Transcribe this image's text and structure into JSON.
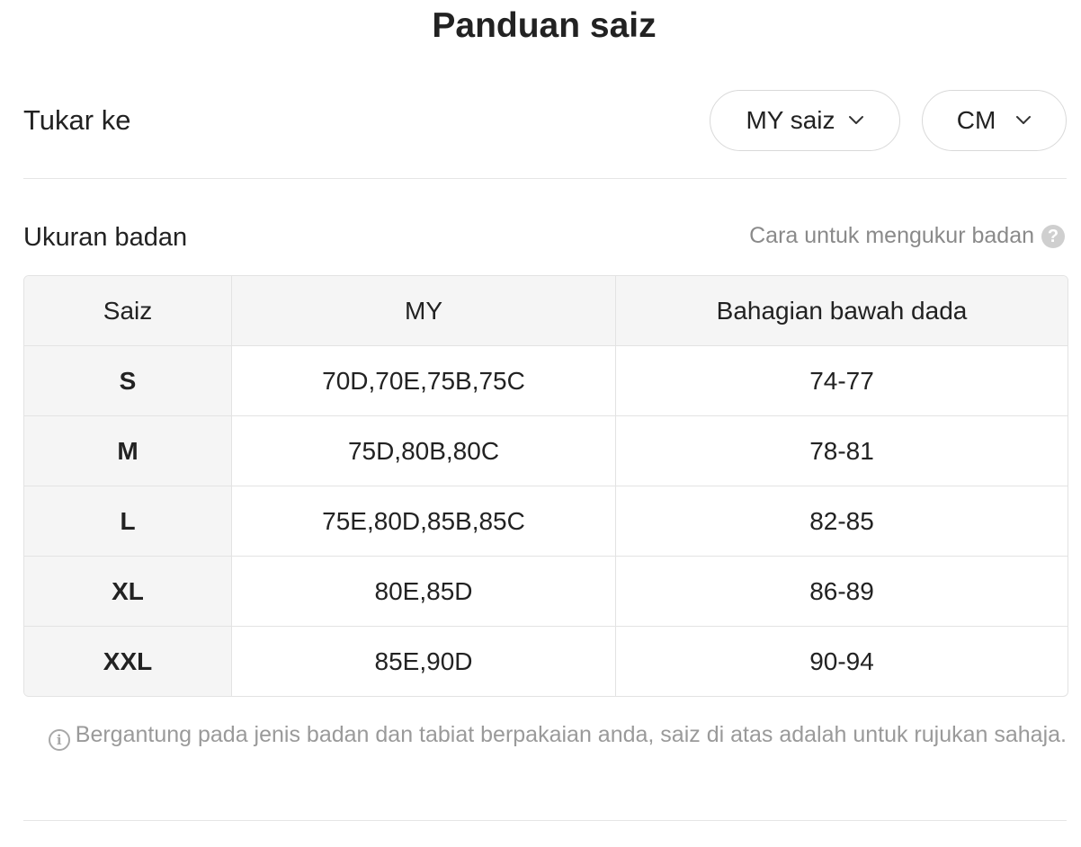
{
  "title": "Panduan saiz",
  "switch": {
    "label": "Tukar ke",
    "size_system": "MY saiz",
    "unit": "CM"
  },
  "section": {
    "title": "Ukuran badan",
    "how_to_link": "Cara untuk mengukur badan",
    "help_icon_glyph": "?"
  },
  "table": {
    "headers": [
      "Saiz",
      "MY",
      "Bahagian bawah dada"
    ],
    "rows": [
      {
        "size": "S",
        "my": "70D,70E,75B,75C",
        "underbust": "74-77"
      },
      {
        "size": "M",
        "my": "75D,80B,80C",
        "underbust": "78-81"
      },
      {
        "size": "L",
        "my": "75E,80D,85B,85C",
        "underbust": "82-85"
      },
      {
        "size": "XL",
        "my": "80E,85D",
        "underbust": "86-89"
      },
      {
        "size": "XXL",
        "my": "85E,90D",
        "underbust": "90-94"
      }
    ]
  },
  "disclaimer": {
    "icon": "info-icon",
    "icon_glyph": "i",
    "text": "Bergantung pada jenis badan dan tabiat berpakaian anda, saiz di atas adalah untuk rujukan sahaja."
  },
  "colors": {
    "text": "#222222",
    "muted": "#8a8a8a",
    "border": "#e3e3e3",
    "header_bg": "#f5f5f5"
  },
  "icons": {
    "dropdown": "chevron-down-icon",
    "help": "question-circle-icon"
  }
}
